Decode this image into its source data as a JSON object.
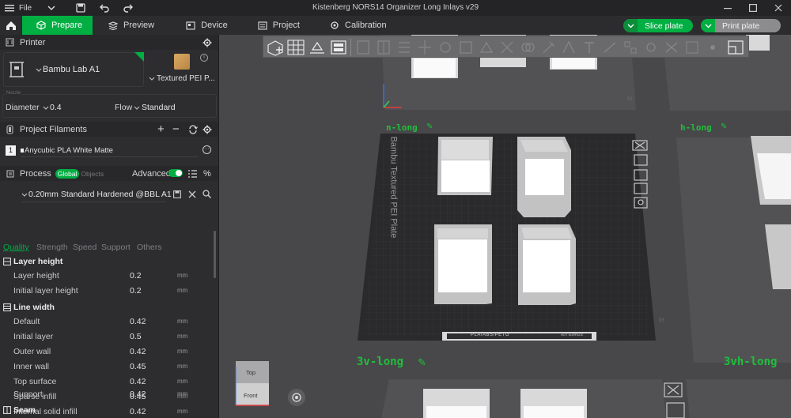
{
  "titlebar": {
    "menu_label": "File",
    "title": "Kistenberg NORS14 Organizer Long Inlays v29"
  },
  "navbar": {
    "tabs": [
      {
        "label": "Prepare",
        "icon": "cube-icon"
      },
      {
        "label": "Preview",
        "icon": "layers-icon"
      },
      {
        "label": "Device",
        "icon": "device-icon"
      },
      {
        "label": "Project",
        "icon": "project-icon"
      },
      {
        "label": "Calibration",
        "icon": "calibration-icon"
      }
    ],
    "slice_label": "Slice plate",
    "print_label": "Print plate"
  },
  "printer": {
    "header": "Printer",
    "name": "Bambu Lab A1",
    "plate": "Textured PEI P...",
    "nozzle_section": "Nozzle",
    "diameter_label": "Diameter",
    "diameter_value": "0.4",
    "flow_label": "Flow",
    "flow_value": "Standard"
  },
  "filaments": {
    "header": "Project Filaments",
    "items": [
      {
        "index": "1",
        "name": "Anycubic PLA White Matte",
        "color": "#f2f2f2"
      }
    ]
  },
  "process": {
    "header": "Process",
    "global_label": "Global",
    "objects_label": "Objects",
    "advanced_label": "Advanced",
    "preset": "0.20mm Standard Hardened @BBL A1",
    "subtabs": [
      "Quality",
      "Strength",
      "Speed",
      "Support",
      "Others"
    ],
    "groups": [
      {
        "title": "Layer height",
        "rows": [
          {
            "label": "Layer height",
            "value": "0.2",
            "unit": "mm"
          },
          {
            "label": "Initial layer height",
            "value": "0.2",
            "unit": "mm"
          }
        ]
      },
      {
        "title": "Line width",
        "rows": [
          {
            "label": "Default",
            "value": "0.42",
            "unit": "mm"
          },
          {
            "label": "Initial layer",
            "value": "0.5",
            "unit": "mm"
          },
          {
            "label": "Outer wall",
            "value": "0.42",
            "unit": "mm"
          },
          {
            "label": "Inner wall",
            "value": "0.45",
            "unit": "mm"
          },
          {
            "label": "Top surface",
            "value": "0.42",
            "unit": "mm"
          },
          {
            "label": "Sparse infill",
            "value": "0.45",
            "unit": "mm"
          },
          {
            "label": "Internal solid infill",
            "value": "0.42",
            "unit": "mm"
          },
          {
            "label": "Support",
            "value": "0.42",
            "unit": "mm"
          }
        ]
      },
      {
        "title": "Seam",
        "rows": []
      }
    ]
  },
  "viewport": {
    "plate_text": "Bambu Textured PEI Plate",
    "plate_labels": [
      "n-long",
      "h-long",
      "3v-long",
      "3vh-long"
    ],
    "plate_numbers": [
      "01",
      "03"
    ],
    "bed_strip": "PLA/ABS/PETG",
    "bed_strip_small": "HOT SURFACE",
    "navcube_top": "Top",
    "navcube_front": "Front"
  },
  "colors": {
    "accent": "#00ae42",
    "panel": "#2d2d30",
    "viewport": "#48484b",
    "plate": "#2c2c2e",
    "label_green": "#1fbf3a"
  }
}
